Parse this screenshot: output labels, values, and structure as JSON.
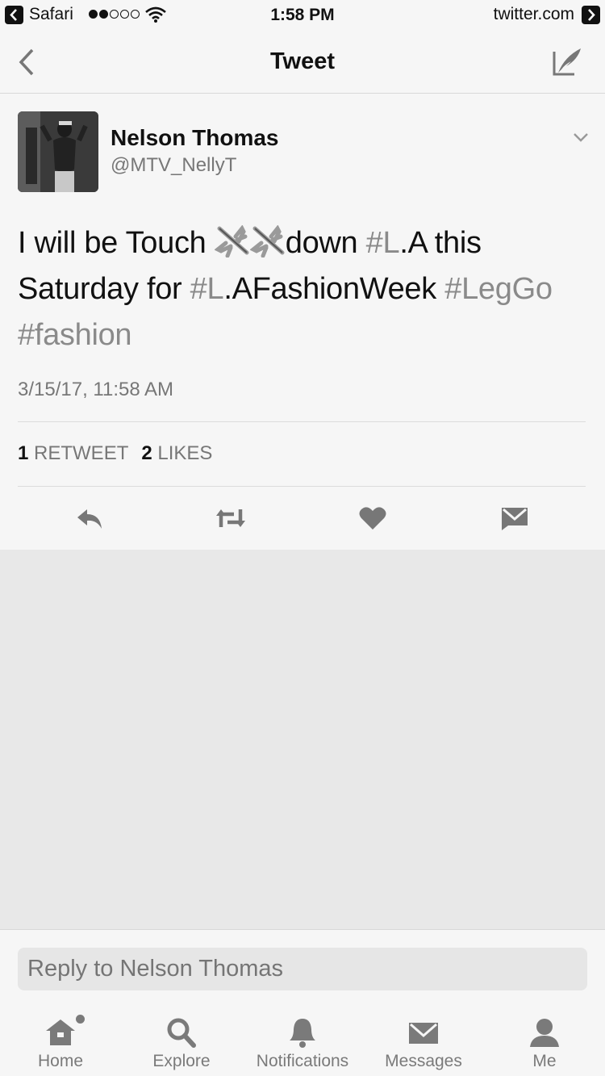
{
  "status_bar": {
    "app": "Safari",
    "time": "1:58 PM",
    "url": "twitter.com"
  },
  "nav": {
    "title": "Tweet"
  },
  "tweet": {
    "name": "Nelson Thomas",
    "handle": "@MTV_NellyT",
    "text": {
      "p1": "I will be Touch ",
      "p2": "down ",
      "tag1": "#L",
      "p3": ".A this Saturday for ",
      "tag2": "#L",
      "p4": ".AFashionWeek ",
      "tag3": "#LegGo",
      "tag4": "#fashion"
    },
    "timestamp": "3/15/17, 11:58 AM",
    "retweet_count": "1",
    "retweet_label": "RETWEET",
    "like_count": "2",
    "like_label": "LIKES"
  },
  "reply": {
    "placeholder": "Reply to Nelson Thomas"
  },
  "tabs": [
    {
      "label": "Home",
      "icon": "home-icon"
    },
    {
      "label": "Explore",
      "icon": "search-icon"
    },
    {
      "label": "Notifications",
      "icon": "bell-icon"
    },
    {
      "label": "Messages",
      "icon": "envelope-icon"
    },
    {
      "label": "Me",
      "icon": "person-icon"
    }
  ],
  "colors": {
    "background": "#f6f6f6",
    "empty_area": "#e8e8e8",
    "hashtag": "#8a8a8a",
    "muted": "#777777"
  }
}
